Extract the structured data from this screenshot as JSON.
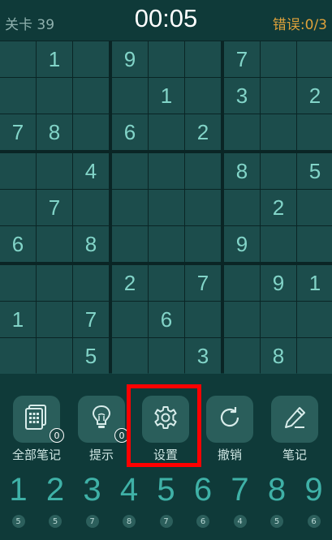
{
  "header": {
    "level": "关卡 39",
    "timer": "00:05",
    "mistakes": "错误:0/3"
  },
  "board": [
    [
      "",
      "1",
      "",
      "9",
      "",
      "",
      "7",
      "",
      ""
    ],
    [
      "",
      "",
      "",
      "",
      "1",
      "",
      "3",
      "",
      "2"
    ],
    [
      "7",
      "8",
      "",
      "6",
      "",
      "2",
      "",
      "",
      ""
    ],
    [
      "",
      "",
      "4",
      "",
      "",
      "",
      "8",
      "",
      "5"
    ],
    [
      "",
      "7",
      "",
      "",
      "",
      "",
      "",
      "2",
      ""
    ],
    [
      "6",
      "",
      "8",
      "",
      "",
      "",
      "9",
      "",
      ""
    ],
    [
      "",
      "",
      "",
      "2",
      "",
      "7",
      "",
      "9",
      "1"
    ],
    [
      "1",
      "",
      "7",
      "",
      "6",
      "",
      "",
      "",
      ""
    ],
    [
      "",
      "",
      "5",
      "",
      "",
      "3",
      "",
      "8",
      ""
    ]
  ],
  "actions": [
    {
      "name": "all-notes-button",
      "icon": "notes-grid-icon",
      "label": "全部笔记",
      "badge": "0"
    },
    {
      "name": "hint-button",
      "icon": "lightbulb-icon",
      "label": "提示",
      "badge": "0"
    },
    {
      "name": "settings-button",
      "icon": "gear-icon",
      "label": "设置"
    },
    {
      "name": "undo-button",
      "icon": "undo-icon",
      "label": "撤销"
    },
    {
      "name": "notes-button",
      "icon": "pencil-icon",
      "label": "笔记"
    }
  ],
  "numpad": [
    {
      "digit": "1",
      "remaining": "5"
    },
    {
      "digit": "2",
      "remaining": "5"
    },
    {
      "digit": "3",
      "remaining": "7"
    },
    {
      "digit": "4",
      "remaining": "8"
    },
    {
      "digit": "5",
      "remaining": "7"
    },
    {
      "digit": "6",
      "remaining": "6"
    },
    {
      "digit": "7",
      "remaining": "4"
    },
    {
      "digit": "8",
      "remaining": "5"
    },
    {
      "digit": "9",
      "remaining": "6"
    }
  ],
  "colors": {
    "background": "#0f3a39",
    "cell": "#1c4d4c",
    "given_digit": "#82d4c8",
    "mistakes": "#e0a23a",
    "highlight": "#ff0000"
  }
}
